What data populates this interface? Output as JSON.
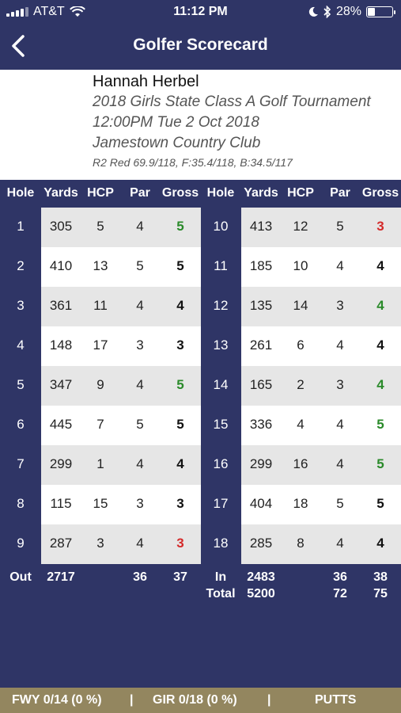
{
  "status_bar": {
    "carrier": "AT&T",
    "time": "11:12 PM",
    "battery": "28%",
    "battery_level": 0.28
  },
  "nav": {
    "title": "Golfer Scorecard"
  },
  "player": {
    "name": "Hannah Herbel",
    "tournament": "2018 Girls State Class A Golf Tournament",
    "datetime": "12:00PM Tue 2 Oct 2018",
    "course": "Jamestown Country Club",
    "tees": "R2 Red 69.9/118, F:35.4/118, B:34.5/117"
  },
  "headers": {
    "hole": "Hole",
    "yards": "Yards",
    "hcp": "HCP",
    "par": "Par",
    "gross": "Gross"
  },
  "colors": {
    "over": "#000000",
    "par": "#2a8a2a",
    "birdie": "#d42a2a"
  },
  "front_nine": [
    {
      "hole": "1",
      "yards": "305",
      "hcp": "5",
      "par": "4",
      "gross": "5"
    },
    {
      "hole": "2",
      "yards": "410",
      "hcp": "13",
      "par": "5",
      "gross": "5"
    },
    {
      "hole": "3",
      "yards": "361",
      "hcp": "11",
      "par": "4",
      "gross": "4"
    },
    {
      "hole": "4",
      "yards": "148",
      "hcp": "17",
      "par": "3",
      "gross": "3"
    },
    {
      "hole": "5",
      "yards": "347",
      "hcp": "9",
      "par": "4",
      "gross": "5"
    },
    {
      "hole": "6",
      "yards": "445",
      "hcp": "7",
      "par": "5",
      "gross": "5"
    },
    {
      "hole": "7",
      "yards": "299",
      "hcp": "1",
      "par": "4",
      "gross": "4"
    },
    {
      "hole": "8",
      "yards": "115",
      "hcp": "15",
      "par": "3",
      "gross": "3"
    },
    {
      "hole": "9",
      "yards": "287",
      "hcp": "3",
      "par": "4",
      "gross": "3"
    }
  ],
  "front_gross_colors": [
    "#2a8a2a",
    "#111111",
    "#111111",
    "#111111",
    "#2a8a2a",
    "#111111",
    "#111111",
    "#111111",
    "#d42a2a"
  ],
  "back_nine": [
    {
      "hole": "10",
      "yards": "413",
      "hcp": "12",
      "par": "5",
      "gross": "3"
    },
    {
      "hole": "11",
      "yards": "185",
      "hcp": "10",
      "par": "4",
      "gross": "4"
    },
    {
      "hole": "12",
      "yards": "135",
      "hcp": "14",
      "par": "3",
      "gross": "4"
    },
    {
      "hole": "13",
      "yards": "261",
      "hcp": "6",
      "par": "4",
      "gross": "4"
    },
    {
      "hole": "14",
      "yards": "165",
      "hcp": "2",
      "par": "3",
      "gross": "4"
    },
    {
      "hole": "15",
      "yards": "336",
      "hcp": "4",
      "par": "4",
      "gross": "5"
    },
    {
      "hole": "16",
      "yards": "299",
      "hcp": "16",
      "par": "4",
      "gross": "5"
    },
    {
      "hole": "17",
      "yards": "404",
      "hcp": "18",
      "par": "5",
      "gross": "5"
    },
    {
      "hole": "18",
      "yards": "285",
      "hcp": "8",
      "par": "4",
      "gross": "4"
    }
  ],
  "back_gross_colors": [
    "#d42a2a",
    "#111111",
    "#2a8a2a",
    "#111111",
    "#2a8a2a",
    "#2a8a2a",
    "#2a8a2a",
    "#111111",
    "#111111"
  ],
  "totals": {
    "out_label": "Out",
    "out_yards": "2717",
    "out_par": "36",
    "out_gross": "37",
    "in_label": "In",
    "in_yards": "2483",
    "in_par": "36",
    "in_gross": "38",
    "total_label": "Total",
    "total_yards": "5200",
    "total_par": "72",
    "total_gross": "75"
  },
  "stats_bar": {
    "fwy": "FWY 0/14 (0 %)",
    "sep1": "|",
    "gir": "GIR 0/18 (0 %)",
    "sep2": "|",
    "putts": "PUTTS"
  }
}
